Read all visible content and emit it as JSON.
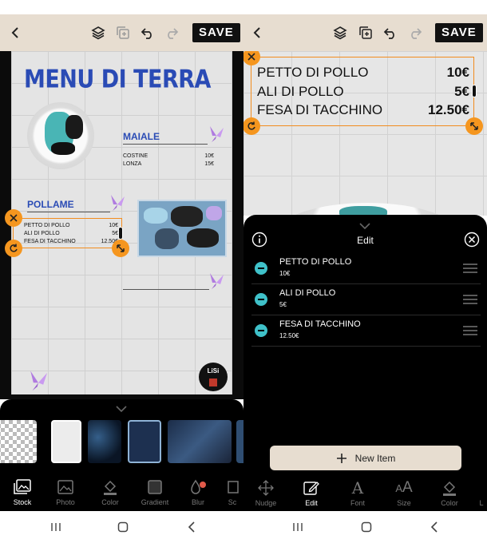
{
  "left": {
    "toolbar": {
      "save_label": "SAVE"
    },
    "poster": {
      "title": "MENU DI TERRA",
      "sections": [
        {
          "name": "MAIALE",
          "items": [
            {
              "name": "COSTINE",
              "price": "10€"
            },
            {
              "name": "LONZA",
              "price": "15€"
            }
          ]
        },
        {
          "name": "POLLAME",
          "items": [
            {
              "name": "PETTO DI POLLO",
              "price": "10€"
            },
            {
              "name": "ALI DI POLLO",
              "price": "5€"
            },
            {
              "name": "FESA DI TACCHINO",
              "price": "12.50€"
            }
          ]
        }
      ],
      "badge_text": "LiSi"
    },
    "bottom_tabs": [
      {
        "label": "Stock",
        "icon": "image-stack-icon",
        "active": true
      },
      {
        "label": "Photo",
        "icon": "photo-icon",
        "active": false
      },
      {
        "label": "Color",
        "icon": "paint-bucket-icon",
        "active": false
      },
      {
        "label": "Gradient",
        "icon": "gradient-icon",
        "active": false
      },
      {
        "label": "Blur",
        "icon": "blur-drop-icon",
        "active": false
      },
      {
        "label": "Sc",
        "icon": "scale-icon",
        "active": false
      }
    ]
  },
  "right": {
    "toolbar": {
      "save_label": "SAVE"
    },
    "canvas_items": [
      {
        "name": "PETTO DI POLLO",
        "price": "10€"
      },
      {
        "name": "ALI DI POLLO",
        "price": "5€"
      },
      {
        "name": "FESA DI TACCHINO",
        "price": "12.50€"
      }
    ],
    "edit_panel": {
      "title": "Edit",
      "items": [
        {
          "name": "PETTO DI POLLO",
          "price": "10€"
        },
        {
          "name": "ALI DI POLLO",
          "price": "5€"
        },
        {
          "name": "FESA DI TACCHINO",
          "price": "12.50€"
        }
      ],
      "new_item_label": "New Item"
    },
    "bottom_tabs": [
      {
        "label": "Nudge",
        "icon": "move-arrows-icon",
        "active": false
      },
      {
        "label": "Edit",
        "icon": "edit-pencil-icon",
        "active": true
      },
      {
        "label": "Font",
        "icon": "font-a-icon",
        "active": false
      },
      {
        "label": "Size",
        "icon": "text-size-icon",
        "active": false
      },
      {
        "label": "Color",
        "icon": "paint-bucket-icon",
        "active": false
      },
      {
        "label": "L",
        "icon": "line-icon",
        "active": false
      }
    ]
  },
  "colors": {
    "accent_orange": "#f5961f",
    "title_blue": "#2a4bb5",
    "teal": "#3fc1c9",
    "toolbar_bg": "#e7ddd0"
  }
}
